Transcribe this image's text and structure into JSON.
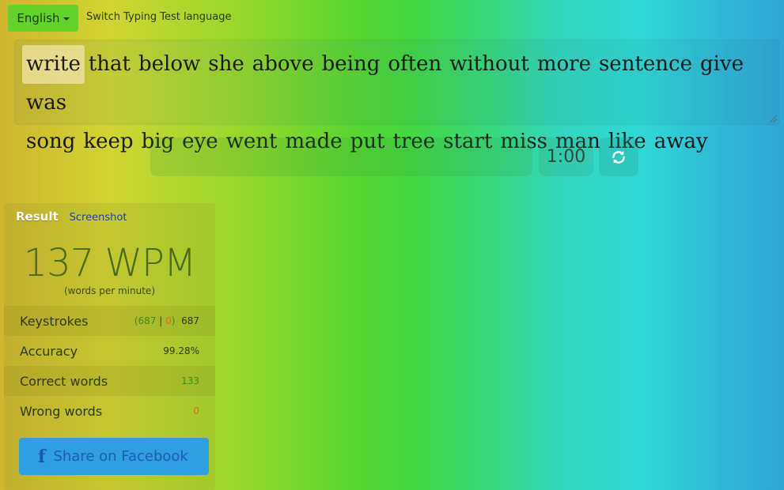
{
  "header": {
    "language": "English",
    "switch_label": "Switch Typing Test language"
  },
  "words": {
    "current": "write",
    "line1": [
      "that",
      "below",
      "she",
      "above",
      "being",
      "often",
      "without",
      "more",
      "sentence",
      "give",
      "was"
    ],
    "line2": [
      "song",
      "keep",
      "big",
      "eye",
      "went",
      "made",
      "put",
      "tree",
      "start",
      "miss",
      "man",
      "like",
      "away"
    ]
  },
  "controls": {
    "timer": "1:00",
    "refresh_icon": "refresh-icon"
  },
  "result": {
    "tab_result": "Result",
    "tab_screenshot": "Screenshot",
    "wpm": "137 WPM",
    "wpm_sub": "(words per minute)",
    "keystrokes": {
      "label": "Keystrokes",
      "correct": "687",
      "wrong": "0",
      "total": "687"
    },
    "accuracy": {
      "label": "Accuracy",
      "value": "99.28%"
    },
    "correct_words": {
      "label": "Correct words",
      "value": "133"
    },
    "wrong_words": {
      "label": "Wrong words",
      "value": "0"
    },
    "facebook_label": "Share on Facebook",
    "facebook_icon": "f"
  },
  "colors": {
    "accent_green": "#63d22b",
    "facebook_blue": "#2f9fe0",
    "correct_green": "#3f8a1a",
    "error_orange": "#e06a1a"
  }
}
